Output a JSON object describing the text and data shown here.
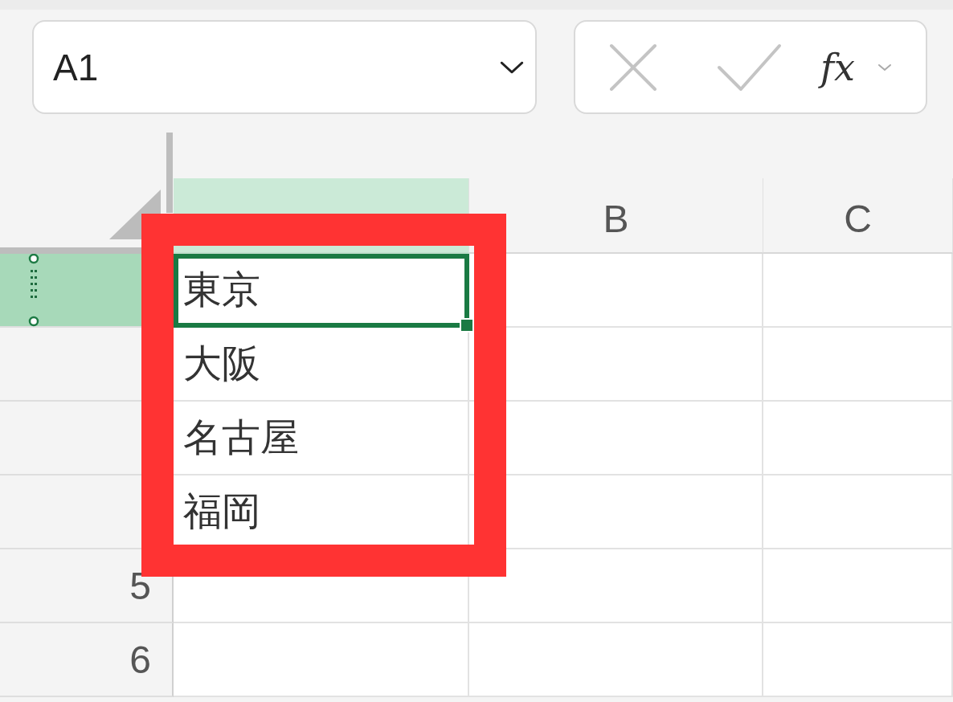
{
  "name_box": {
    "value": "A1"
  },
  "formula_bar": {
    "function_label": "fx",
    "cancel_disabled": true,
    "enter_disabled": true
  },
  "columns": [
    {
      "selected": true
    },
    {
      "label": "B",
      "selected": false
    },
    {
      "label": "C",
      "selected": false
    }
  ],
  "rows": [
    {
      "selected": true,
      "cells": [
        {
          "text": "東京",
          "selected": true
        }
      ]
    },
    {
      "selected": false,
      "cells": [
        {
          "text": "大阪",
          "selected": false
        }
      ]
    },
    {
      "selected": false,
      "cells": [
        {
          "text": "名古屋",
          "selected": false
        }
      ]
    },
    {
      "selected": false,
      "cells": [
        {
          "text": "福岡",
          "selected": false
        }
      ]
    },
    {
      "number": "5",
      "selected": false
    },
    {
      "number": "6",
      "selected": false
    }
  ],
  "annotation": {
    "kind": "frame",
    "color": "#ff3333"
  }
}
